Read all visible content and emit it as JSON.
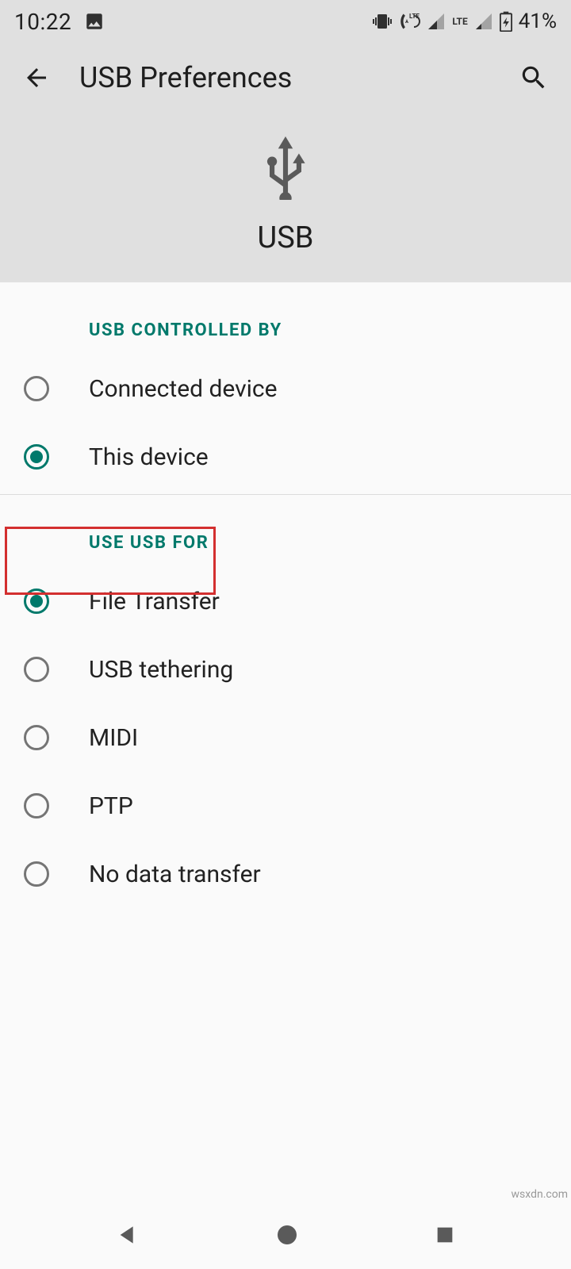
{
  "status": {
    "time": "10:22",
    "battery_text": "41%"
  },
  "appbar": {
    "title": "USB Preferences"
  },
  "hero": {
    "label": "USB"
  },
  "sections": {
    "controlled_by": {
      "header": "USB CONTROLLED BY",
      "options": [
        {
          "label": "Connected device",
          "checked": false
        },
        {
          "label": "This device",
          "checked": true
        }
      ]
    },
    "use_for": {
      "header": "USE USB FOR",
      "options": [
        {
          "label": "File Transfer",
          "checked": true
        },
        {
          "label": "USB tethering",
          "checked": false
        },
        {
          "label": "MIDI",
          "checked": false
        },
        {
          "label": "PTP",
          "checked": false
        },
        {
          "label": "No data transfer",
          "checked": false
        }
      ]
    }
  },
  "watermark": "wsxdn.com"
}
